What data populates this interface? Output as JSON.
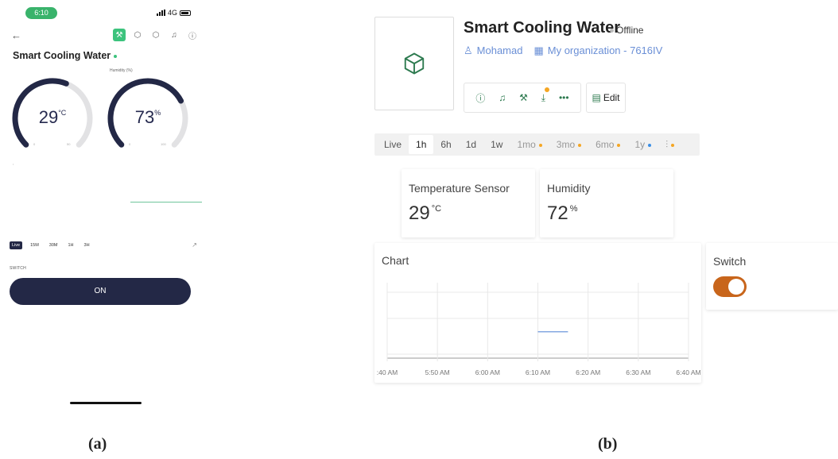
{
  "phone": {
    "time": "6:10",
    "network": "4G",
    "title": "Smart Cooling Water",
    "gauges": [
      {
        "caption": "",
        "value": "29",
        "unit": "°C",
        "min": "0",
        "max": "50",
        "level": 0.58
      },
      {
        "caption": "Humidity (%)",
        "value": "73",
        "unit": "%",
        "min": "0",
        "max": "100",
        "level": 0.73
      }
    ],
    "time_buttons": [
      "Live",
      "15M",
      "30M",
      "1H",
      "3H"
    ],
    "switch_label": "SWITCH",
    "on_label": "ON"
  },
  "dashboard": {
    "title": "Smart Cooling Water",
    "status": "Offline",
    "owner": "Mohamad",
    "organization": "My organization - 7616IV",
    "edit_label": "Edit",
    "time_ranges": [
      {
        "label": "Live",
        "dot": ""
      },
      {
        "label": "1h",
        "dot": "",
        "active": true
      },
      {
        "label": "6h",
        "dot": ""
      },
      {
        "label": "1d",
        "dot": ""
      },
      {
        "label": "1w",
        "dot": ""
      },
      {
        "label": "1mo",
        "dot": "#f5a623"
      },
      {
        "label": "3mo",
        "dot": "#f5a623"
      },
      {
        "label": "6mo",
        "dot": "#f5a623"
      },
      {
        "label": "1y",
        "dot": "#3a8ee6"
      }
    ],
    "temperature": {
      "label": "Temperature Sensor",
      "value": "29",
      "unit": "°C"
    },
    "humidity": {
      "label": "Humidity",
      "value": "72",
      "unit": "%"
    },
    "chart_label": "Chart",
    "switch_label": "Switch",
    "switch_on": true
  },
  "captions": {
    "a": "(a)",
    "b": "(b)"
  },
  "colors": {
    "accent_green": "#3cc37d",
    "navy": "#232846",
    "link_blue": "#6a8fd6",
    "toggle_orange": "#c8651b",
    "badge_orange": "#f5a623"
  },
  "chart_data": {
    "type": "line",
    "title": "Chart",
    "x_ticks": [
      ":40 AM",
      "5:50 AM",
      "6:00 AM",
      "6:10 AM",
      "6:20 AM",
      "6:30 AM",
      "6:40 AM"
    ],
    "series": [
      {
        "x": [
          "6:10 AM",
          "6:16 AM"
        ],
        "y": [
          0.5,
          0.5
        ]
      }
    ],
    "grid": true
  }
}
